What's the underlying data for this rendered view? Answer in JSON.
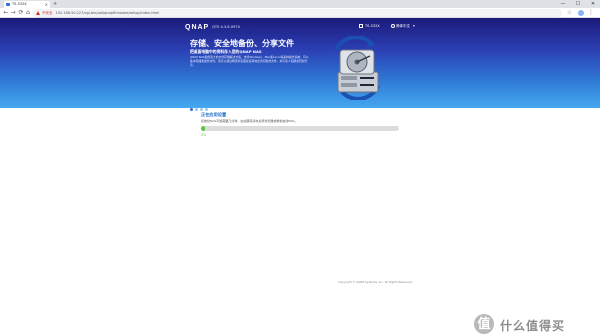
{
  "browser": {
    "tab_title": "TS-532X",
    "new_tab_symbol": "+",
    "minimize": "—",
    "maximize": "☐",
    "close": "✕",
    "nav": {
      "back": "←",
      "forward": "→",
      "reload": "⟳",
      "home": "⌂"
    },
    "security_label": "不安全",
    "url": "192.168.50.227/cgi-bin/qid/qnapfirmware/setup/index.html",
    "star": "☆",
    "menu": "⋮"
  },
  "header": {
    "logo": "QNAP",
    "qts_version": "QTS 4.3.6.0970",
    "model": "TS-532X",
    "language": "简体中文",
    "language_chevron": "▾"
  },
  "hero": {
    "title": "存储、安全地备份、分享文件",
    "subtitle": "把桌面电脑中的资料存入您的QNAP NAS",
    "description": "QNAP NAS提供强大的文件存储解决方案，支持Windows、Mac和Linux等多种操作系统，可以集中存储和备份文件。您可以通过网页浏览器在任何地点访问您的文件，并与家人和朋友轻松分享。"
  },
  "carousel": {
    "slide_count": 4,
    "active_index": 0
  },
  "progress": {
    "title": "正在应用设置",
    "text": "初始化NAS可能需要几分钟，在这期间请勿关闭浏览器或重新启动NAS。",
    "percent": 2,
    "percent_label": "2%"
  },
  "footer": {
    "copyright": "Copyright © QNAP Systems, Inc. All Rights Reserved."
  },
  "watermark": {
    "glyph": "值",
    "text": "什么值得买"
  },
  "colors": {
    "accent": "#1e6fc8",
    "progress_green": "#58c63f",
    "banner_top": "#1b1a7a",
    "banner_bottom": "#45a8ef"
  }
}
